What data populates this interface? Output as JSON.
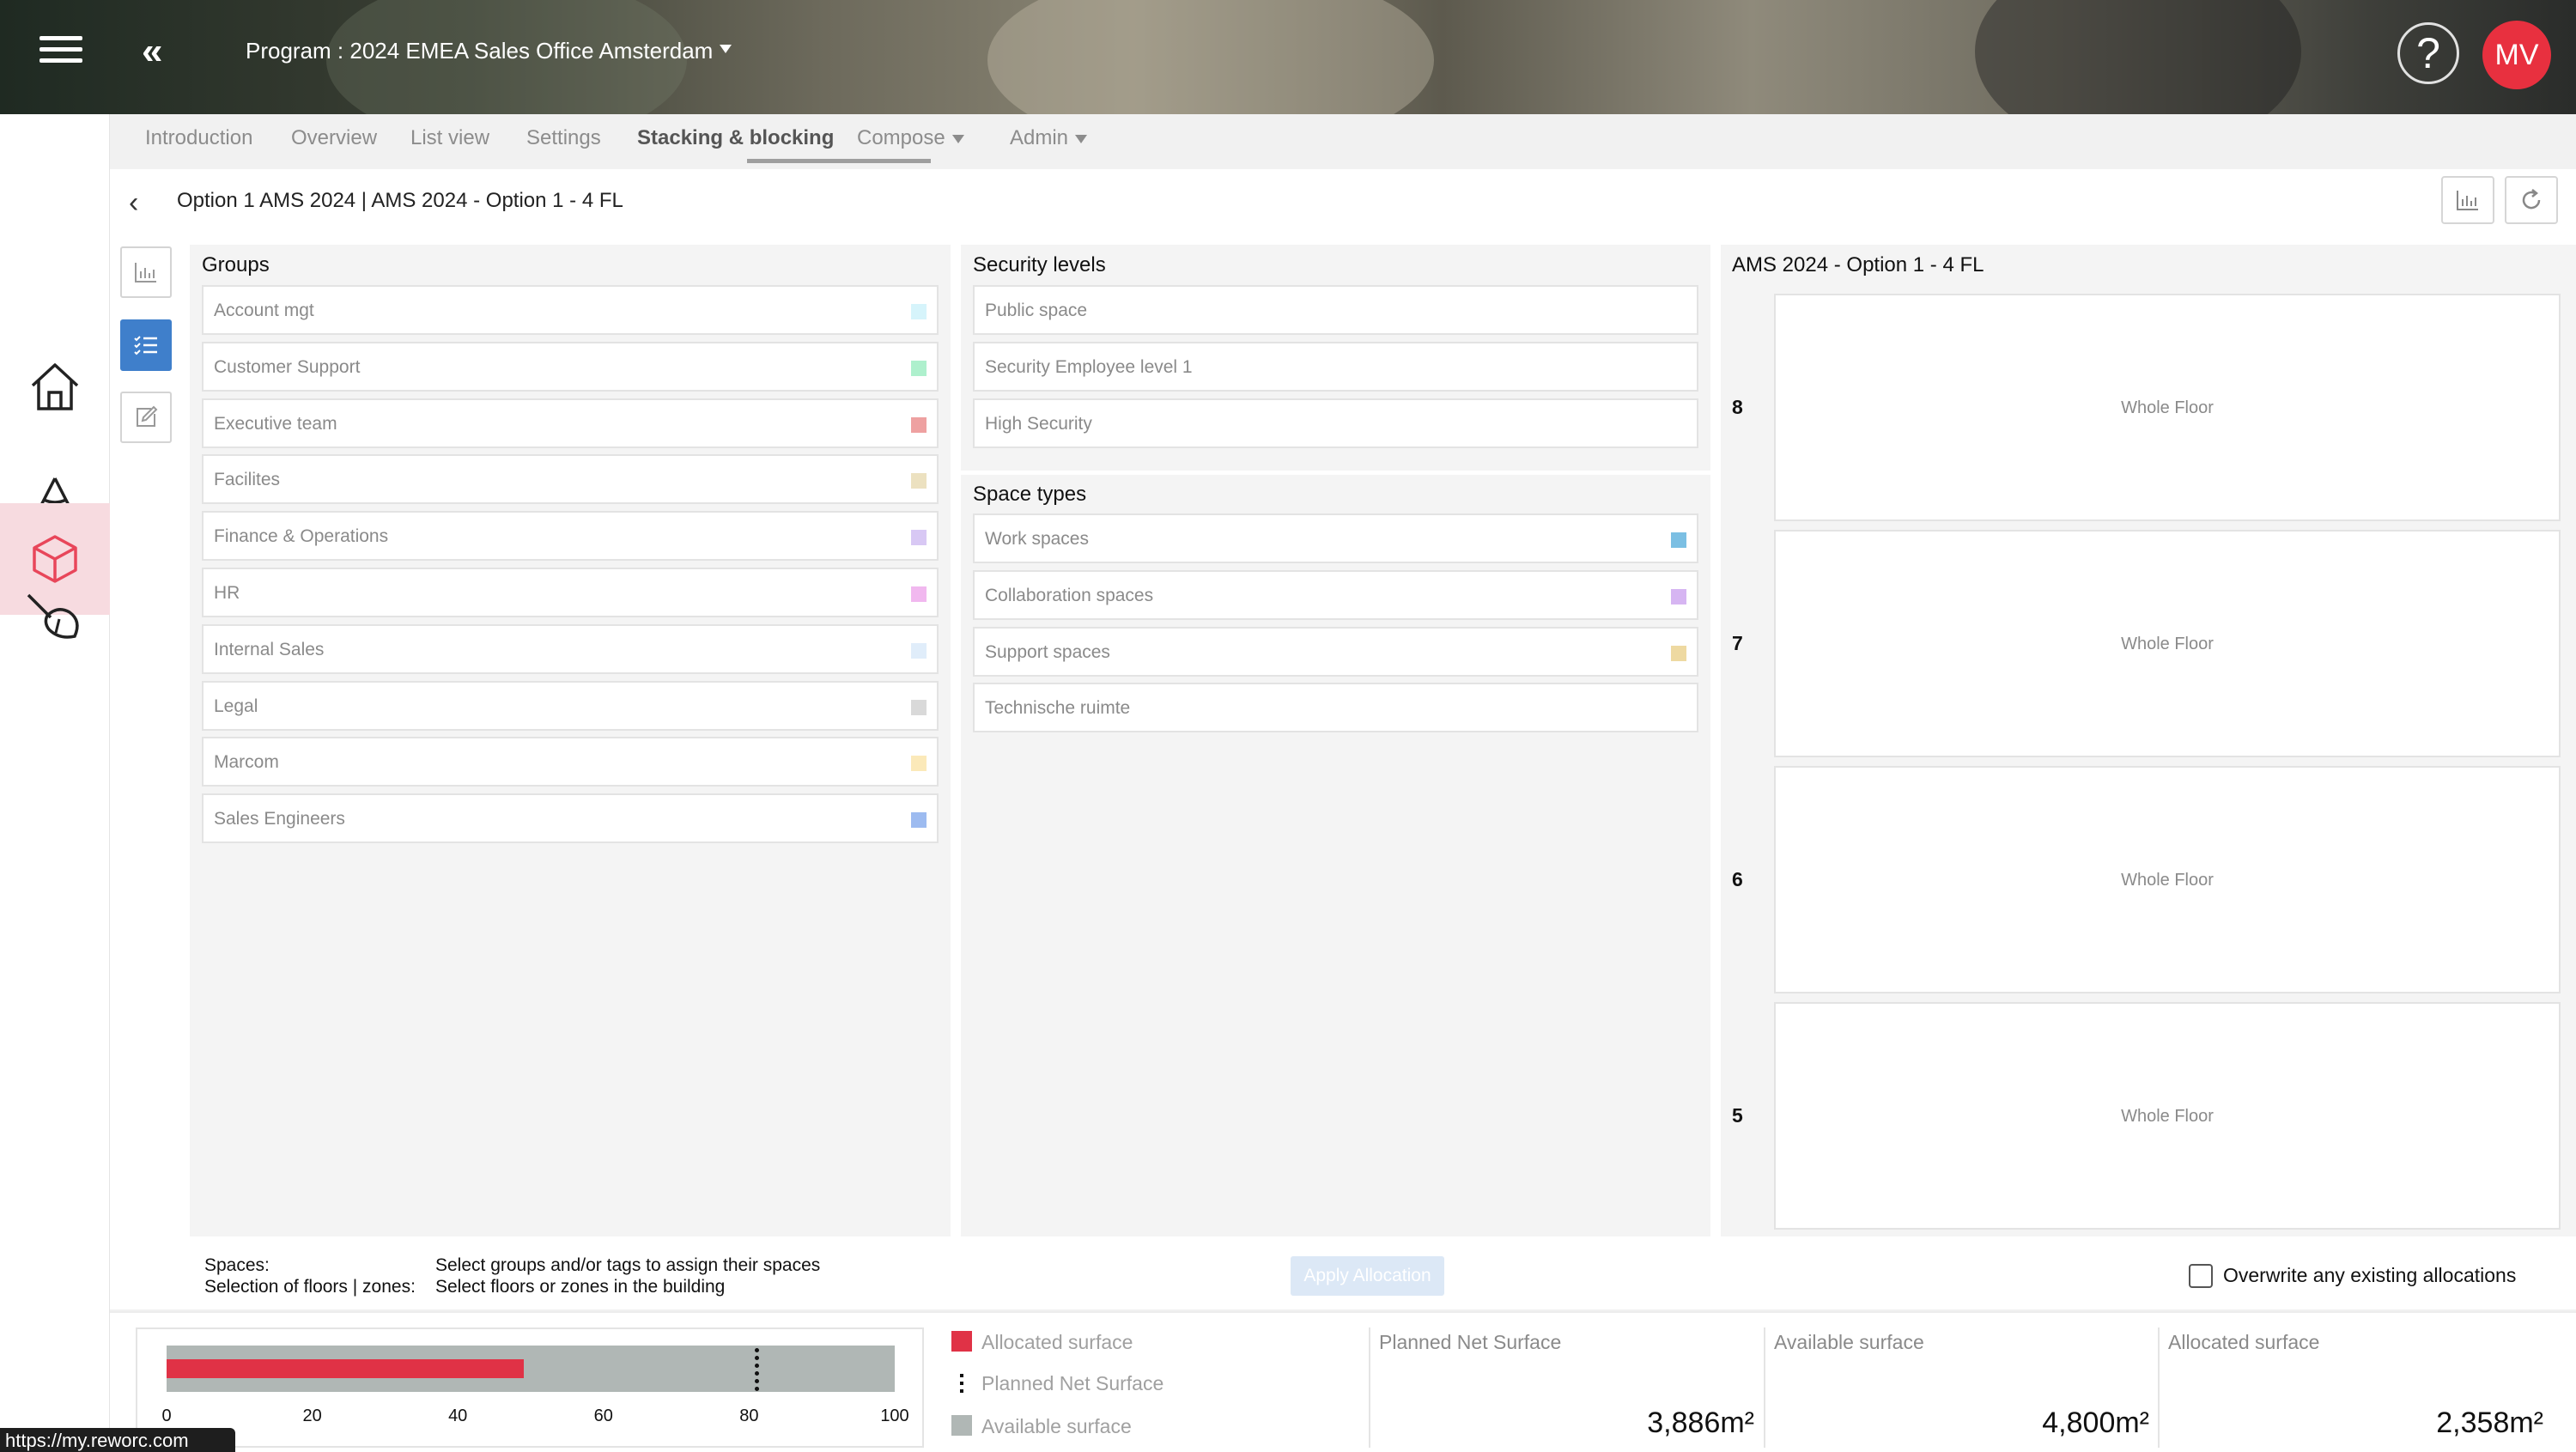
{
  "header": {
    "program_title": "Program : 2024 EMEA Sales Office Amsterdam",
    "avatar_initials": "MV",
    "avatar_color": "#e8303f"
  },
  "sidebar": {
    "icons": [
      "home-icon",
      "cone-icon",
      "cube-icon",
      "paint-brush-icon"
    ]
  },
  "tabs": [
    {
      "label": "Introduction"
    },
    {
      "label": "Overview"
    },
    {
      "label": "List view"
    },
    {
      "label": "Settings"
    },
    {
      "label": "Stacking & blocking",
      "active": true
    },
    {
      "label": "Compose",
      "dropdown": true
    },
    {
      "label": "Admin",
      "dropdown": true
    }
  ],
  "option_title": "Option 1 AMS 2024 | AMS 2024 - Option 1 - 4 FL",
  "groups": {
    "title": "Groups",
    "items": [
      {
        "label": "Account mgt",
        "color": "#d6f4fb"
      },
      {
        "label": "Customer Support",
        "color": "#aef0cd"
      },
      {
        "label": "Executive team",
        "color": "#eea1a1"
      },
      {
        "label": "Facilites",
        "color": "#ece1c0"
      },
      {
        "label": "Finance & Operations",
        "color": "#d8c8f4"
      },
      {
        "label": "HR",
        "color": "#f1b8ef"
      },
      {
        "label": "Internal Sales",
        "color": "#e0edfa"
      },
      {
        "label": "Legal",
        "color": "#d9d9d9"
      },
      {
        "label": "Marcom",
        "color": "#fbe9b9"
      },
      {
        "label": "Sales Engineers",
        "color": "#9dbbf0"
      }
    ]
  },
  "security_levels": {
    "title": "Security levels",
    "items": [
      {
        "label": "Public space"
      },
      {
        "label": "Security Employee level 1"
      },
      {
        "label": "High Security"
      }
    ]
  },
  "space_types": {
    "title": "Space types",
    "items": [
      {
        "label": "Work spaces",
        "color": "#7bbfe3"
      },
      {
        "label": "Collaboration spaces",
        "color": "#d6b5f2"
      },
      {
        "label": "Support spaces",
        "color": "#eed9a1"
      },
      {
        "label": "Technische ruimte",
        "color": ""
      }
    ]
  },
  "building": {
    "title": "AMS 2024 - Option 1 - 4 FL",
    "floors": [
      {
        "number": "8",
        "label": "Whole Floor"
      },
      {
        "number": "7",
        "label": "Whole Floor"
      },
      {
        "number": "6",
        "label": "Whole Floor"
      },
      {
        "number": "5",
        "label": "Whole Floor"
      }
    ]
  },
  "allocation": {
    "spaces_label": "Spaces:",
    "spaces_hint": "Select groups and/or tags to assign their spaces",
    "selection_label": "Selection of floors | zones:",
    "selection_hint": "Select floors or zones in the building",
    "apply_label": "Apply Allocation",
    "overwrite_label": "Overwrite any existing allocations"
  },
  "chart_data": {
    "type": "bar",
    "orientation": "horizontal",
    "x_ticks": [
      "0",
      "20",
      "40",
      "60",
      "80",
      "100"
    ],
    "xlim": [
      0,
      100
    ],
    "available_surface_pct": 100,
    "allocated_surface_pct": 49,
    "planned_net_surface_pct": 81,
    "legend": [
      {
        "label": "Allocated surface",
        "color": "#e03246",
        "marker": "square"
      },
      {
        "label": "Planned Net Surface",
        "color": "#111111",
        "marker": "dotted-line"
      },
      {
        "label": "Available surface",
        "color": "#b0b7b5",
        "marker": "square"
      }
    ]
  },
  "stats": [
    {
      "title": "Planned Net Surface",
      "value": "3,886m²"
    },
    {
      "title": "Available surface",
      "value": "4,800m²"
    },
    {
      "title": "Allocated surface",
      "value": "2,358m²"
    }
  ],
  "status_url": "https://my.reworc.com"
}
